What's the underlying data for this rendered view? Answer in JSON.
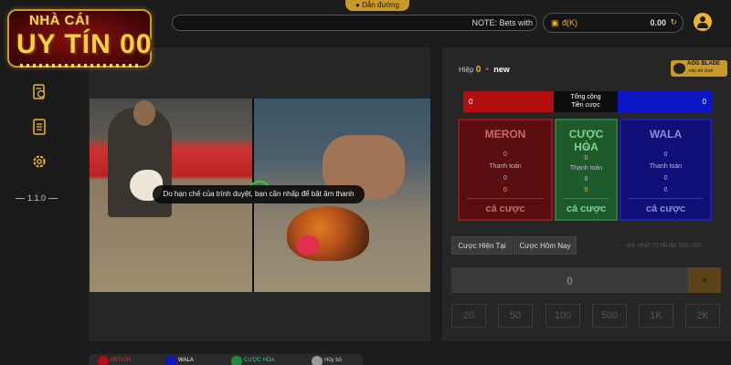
{
  "logo": {
    "line1": "NHÀ CÁI",
    "line2": "UY TÍN 00"
  },
  "sidebar": {
    "version": "1.1.0"
  },
  "topbar": {
    "guide_label": "Dẫn đường",
    "notice": "NOTE: Bets with",
    "currency": "đ(K)",
    "balance": "0.00"
  },
  "video": {
    "toast": "Do hạn chế của trình duyệt, bạn cần nhấp để bật âm thanh"
  },
  "bottom_legend": [
    "MERON",
    "WALA",
    "CƯỢC HÒA",
    "Hủy bỏ"
  ],
  "round": {
    "label": "Hiệp",
    "number": "0",
    "status": "new"
  },
  "aog": {
    "title": "AOG BLADE",
    "subtitle": "vào trò chơi"
  },
  "totals": {
    "meron": "0",
    "label_1": "Tổng cộng",
    "label_2": "Tiền cược",
    "wala": "0"
  },
  "boxes": {
    "meron": {
      "title": "MERON",
      "v1": "0",
      "label": "Thanh toán",
      "v2": "0",
      "v3": "0",
      "cta": "cá cược"
    },
    "draw": {
      "title": "CƯỢC HÒA",
      "v1": "0",
      "v2": "0",
      "label": "Thanh toán",
      "v3": "8",
      "v4": "0",
      "cta": "cá cược"
    },
    "wala": {
      "title": "WALA",
      "v1": "0",
      "label": "Thanh toán",
      "v2": "0",
      "v3": "0",
      "cta": "cá cược"
    }
  },
  "tabs": [
    "Cược Hiện Tại",
    "Cược Hôm Nay"
  ],
  "limits": "nhỏ nhất:20   tối đa:100,000",
  "amount": "0",
  "clear_label": "×",
  "chips": [
    "20",
    "50",
    "100",
    "500",
    "1K",
    "2K"
  ],
  "colors": {
    "meron": "#b30e12",
    "wala": "#0c14c8",
    "draw": "#1f5a2c",
    "accent": "#f0b429"
  }
}
